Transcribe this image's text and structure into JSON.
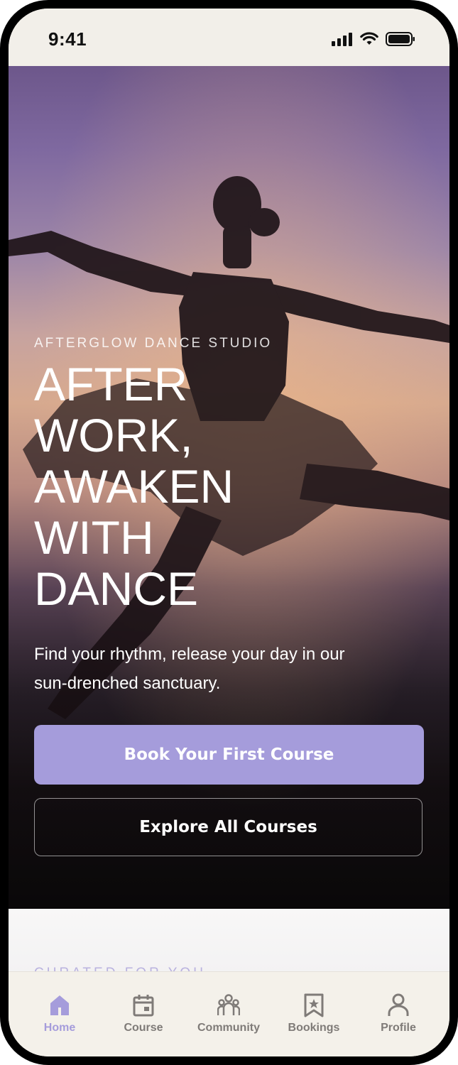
{
  "status_bar": {
    "time": "9:41"
  },
  "hero": {
    "brand": "AFTERGLOW DANCE STUDIO",
    "headline_lines": [
      "AFTER",
      "WORK,",
      "AWAKEN",
      "WITH",
      "DANCE"
    ],
    "subtitle": "Find your rhythm, release your day in our sun-drenched sanctuary.",
    "primary_button": "Book Your First Course",
    "secondary_button": "Explore All Courses"
  },
  "curated": {
    "label": "CURATED FOR YOU"
  },
  "tab_bar": {
    "items": [
      {
        "label": "Home",
        "icon": "home-icon",
        "active": true
      },
      {
        "label": "Course",
        "icon": "calendar-icon",
        "active": false
      },
      {
        "label": "Community",
        "icon": "people-icon",
        "active": false
      },
      {
        "label": "Bookings",
        "icon": "bookmark-star-icon",
        "active": false
      },
      {
        "label": "Profile",
        "icon": "user-icon",
        "active": false
      }
    ]
  },
  "colors": {
    "accent": "#a59cdb",
    "tab_inactive": "#7f7b78",
    "tab_bar_bg": "#f4f1ea"
  }
}
